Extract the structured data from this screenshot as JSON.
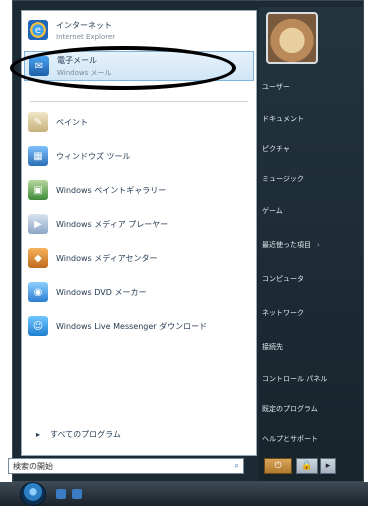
{
  "left": {
    "pinned": [
      {
        "name": "インターネット",
        "sub": "Internet Explorer",
        "icon": "internet-explorer-icon"
      },
      {
        "name": "電子メール",
        "sub": "Windows メール",
        "icon": "windows-mail-icon"
      }
    ],
    "recent": [
      {
        "label": "ペイント",
        "icon": "paint-icon"
      },
      {
        "label": "ウィンドウズ ツール",
        "icon": "tool-icon"
      },
      {
        "label": "Windows ペイントギャラリー",
        "icon": "photo-gallery-icon"
      },
      {
        "label": "Windows メディア プレーヤー",
        "icon": "media-player-icon"
      },
      {
        "label": "Windows メディアセンター",
        "icon": "media-center-icon"
      },
      {
        "label": "Windows DVD メーカー",
        "icon": "dvd-maker-icon"
      },
      {
        "label": "Windows Live Messenger ダウンロード",
        "icon": "messenger-icon"
      }
    ],
    "all_programs": "すべてのプログラム",
    "search_placeholder": "検索の開始"
  },
  "right": {
    "items": [
      {
        "label": "ユーザー",
        "arrow": false
      },
      {
        "label": "ドキュメント",
        "arrow": false
      },
      {
        "label": "ピクチャ",
        "arrow": false
      },
      {
        "label": "ミュージック",
        "arrow": false
      },
      {
        "label": "ゲーム",
        "arrow": false
      },
      {
        "label": "最近使った項目",
        "arrow": true
      },
      {
        "label": "コンピュータ",
        "arrow": false
      },
      {
        "label": "ネットワーク",
        "arrow": false
      },
      {
        "label": "接続先",
        "arrow": false
      },
      {
        "label": "コントロール パネル",
        "arrow": false
      },
      {
        "label": "既定のプログラム",
        "arrow": false
      },
      {
        "label": "ヘルプとサポート",
        "arrow": false
      }
    ]
  }
}
